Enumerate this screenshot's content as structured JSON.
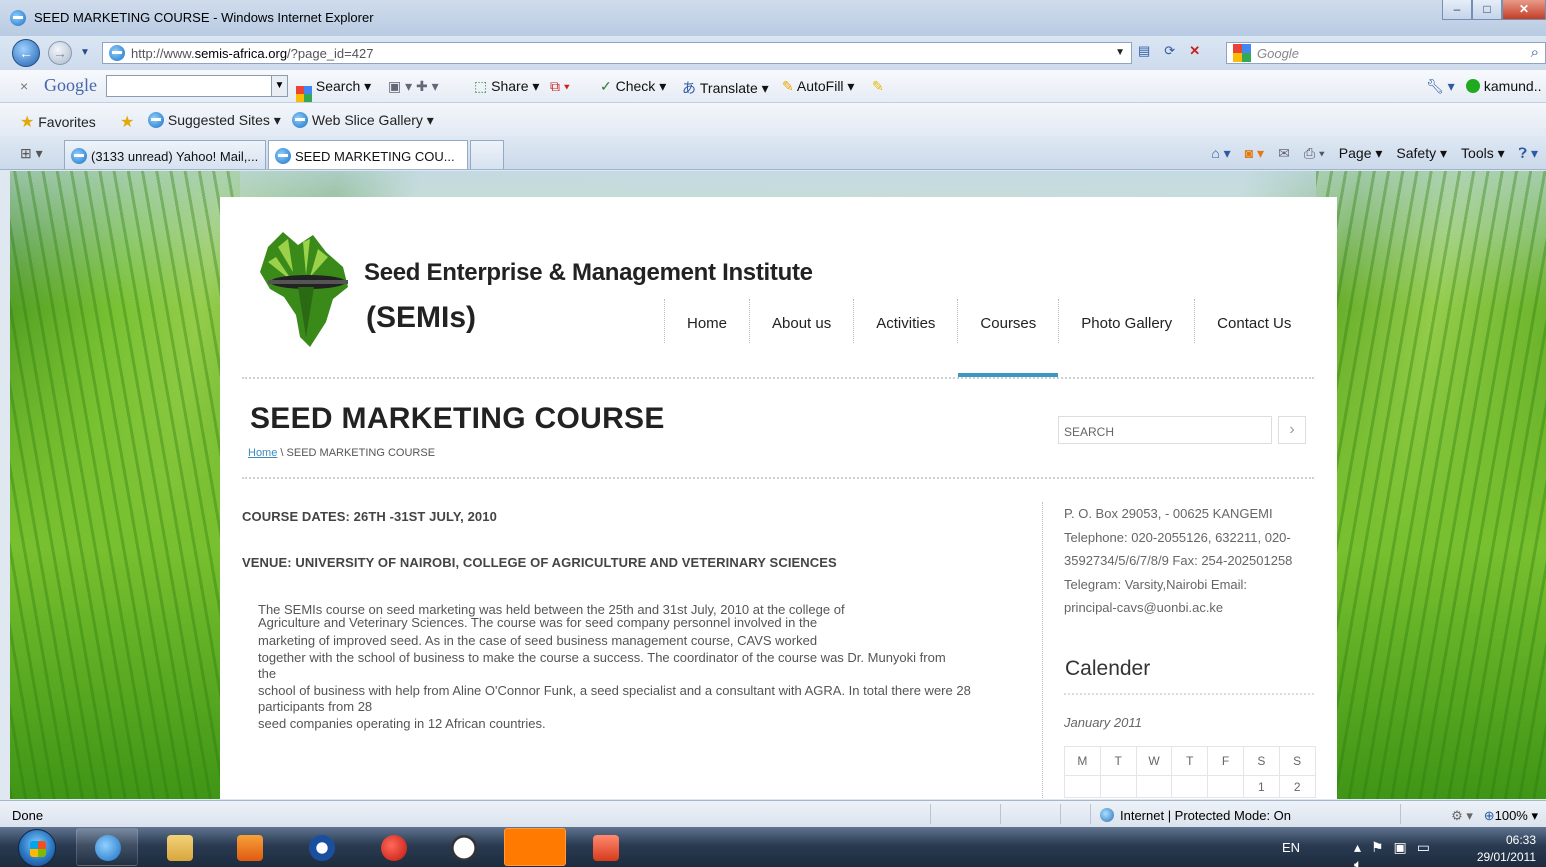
{
  "window": {
    "title": "SEED MARKETING COURSE - Windows Internet Explorer",
    "address_prefix": "http://www.",
    "address_domain": "semis-africa.org",
    "address_path": "/?page_id=427",
    "search_provider": "Google"
  },
  "google_toolbar": {
    "logo": "Google",
    "items": [
      "Search",
      "Share",
      "Check",
      "Translate",
      "AutoFill"
    ],
    "user": "kamund.."
  },
  "favorites_bar": {
    "favorites": "Favorites",
    "items": [
      "Suggested Sites",
      "Web Slice Gallery"
    ]
  },
  "tabs": [
    {
      "label": "(3133 unread) Yahoo! Mail,...",
      "active": false
    },
    {
      "label": "SEED MARKETING COU...",
      "active": true
    }
  ],
  "command_bar": {
    "page": "Page",
    "safety": "Safety",
    "tools": "Tools"
  },
  "site": {
    "name": "Seed Enterprise & Management Institute",
    "abbr": "(SEMIs)",
    "nav": [
      {
        "label": "Home",
        "active": false
      },
      {
        "label": "About us",
        "active": false
      },
      {
        "label": "Activities",
        "active": false
      },
      {
        "label": "Courses",
        "active": true
      },
      {
        "label": "Photo Gallery",
        "active": false
      },
      {
        "label": "Contact Us",
        "active": false
      }
    ],
    "search_placeholder": "SEARCH"
  },
  "page": {
    "title": "SEED MARKETING COURSE",
    "breadcrumb_home": "Home",
    "breadcrumb_sep": " \\ ",
    "breadcrumb_current": "SEED MARKETING COURSE",
    "course_dates": "COURSE DATES: 26TH -31ST JULY, 2010",
    "venue": "VENUE: UNIVERSITY OF NAIROBI, COLLEGE OF AGRICULTURE AND VETERINARY SCIENCES",
    "body_lines": [
      "The SEMIs course on seed marketing was held between the 25th and 31st July, 2010 at the college of",
      "Agriculture and Veterinary Sciences. The course was for seed company personnel involved in the",
      "marketing of improved seed. As in the case of seed business management course, CAVS worked",
      "together with the school of business to make the course a success. The coordinator of the course was Dr. Munyoki from",
      "the",
      "school of business with help from Aline O'Connor Funk, a seed specialist and a consultant with AGRA. In total there were 28 participants from 28",
      "seed companies operating in 12 African countries."
    ]
  },
  "sidebar": {
    "contact_lines": [
      "P. O. Box 29053, - 00625 KANGEMI",
      "Telephone: 020-2055126, 632211, 020-",
      "3592734/5/6/7/8/9 Fax: 254-202501258",
      "Telegram: Varsity,Nairobi Email:",
      "principal-cavs@uonbi.ac.ke"
    ],
    "calendar_title": "Calender",
    "calendar_month": "January 2011",
    "weekdays": [
      "M",
      "T",
      "W",
      "T",
      "F",
      "S",
      "S"
    ],
    "first_row": [
      "",
      "",
      "",
      "",
      "",
      "1",
      "2"
    ]
  },
  "status": {
    "left": "Done",
    "zone": "Internet | Protected Mode: On",
    "zoom": "100%"
  },
  "taskbar": {
    "lang": "EN",
    "time": "06:33",
    "date": "29/01/2011"
  },
  "colors": {
    "accent": "#3b98c2",
    "link": "#3b8abf"
  }
}
